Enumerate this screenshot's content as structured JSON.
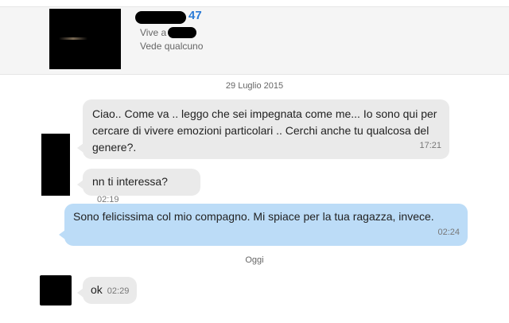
{
  "profile": {
    "age": "47",
    "lives_in_label": "Vive a",
    "relationship_status": "Vede qualcuno"
  },
  "messages_section": [
    {
      "date": "29 Luglio 2015",
      "messages": [
        {
          "direction": "incoming",
          "lines": [
            "Ciao.. Come va .. leggo che sei impegnata come me... Io sono qui per",
            "cercare di vivere emozioni particolari .. Cerchi anche tu qualcosa del",
            "genere?."
          ],
          "time": "17:21"
        },
        {
          "direction": "incoming",
          "text": "nn ti interessa?",
          "time": "02:19"
        },
        {
          "direction": "outgoing",
          "text": "Sono felicissima col mio compagno. Mi spiace per la tua ragazza, invece.",
          "time": "02:24"
        }
      ]
    },
    {
      "date": "Oggi",
      "messages": [
        {
          "direction": "incoming",
          "text": "ok",
          "time": "02:29"
        }
      ]
    }
  ],
  "colors": {
    "incoming_bubble": "#eaeaea",
    "outgoing_bubble": "#bcdcf7",
    "age_accent": "#2b7bd6",
    "redaction": "#000000"
  }
}
